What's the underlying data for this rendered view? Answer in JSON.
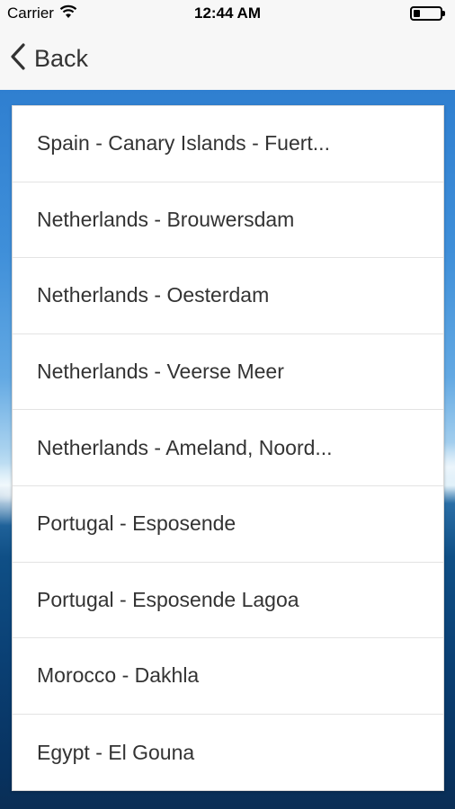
{
  "status_bar": {
    "carrier": "Carrier",
    "time": "12:44 AM",
    "wifi_icon": "wifi-icon",
    "battery_icon": "battery-icon",
    "battery_level": 0.25
  },
  "nav": {
    "back_label": "Back",
    "back_icon": "chevron-left-icon"
  },
  "locations": [
    "Spain - Canary Islands - Fuert...",
    "Netherlands - Brouwersdam",
    "Netherlands - Oesterdam",
    "Netherlands - Veerse Meer",
    "Netherlands - Ameland, Noord...",
    "Portugal - Esposende",
    "Portugal - Esposende Lagoa",
    "Morocco - Dakhla",
    "Egypt - El Gouna"
  ],
  "colors": {
    "text": "#333333",
    "sky": "#3f8fd9",
    "sea": "#0a3f73"
  }
}
